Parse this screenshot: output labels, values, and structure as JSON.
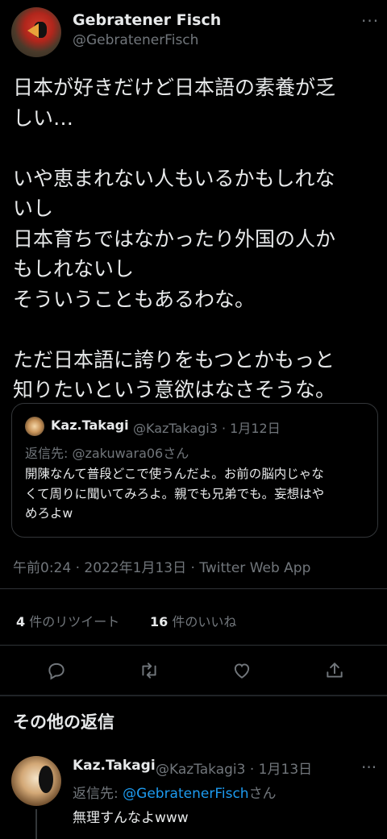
{
  "tweet": {
    "author_name": "Gebratener Fisch",
    "author_handle": "@GebratenerFisch",
    "lines": [
      "日本が好きだけど日本語の素養が乏",
      "しい…",
      "",
      "いや恵まれない人もいるかもしれな",
      "いし",
      "日本育ちではなかったり外国の人か",
      "もしれないし",
      "そういうこともあるわな。",
      "",
      "ただ日本語に誇りをもつとかもっと",
      "知りたいという意欲はなさそうな。"
    ],
    "timestamp": "午前0:24 · 2022年1月13日 · Twitter Web App",
    "retweet_count": "4",
    "retweet_label": "件のリツイート",
    "like_count": "16",
    "like_label": "件のいいね"
  },
  "quote": {
    "author_name": "Kaz.Takagi",
    "author_meta": "@KazTakagi3 · 1月12日",
    "reply_to": "返信先: @zakuwara06さん",
    "lines": [
      "開陳なんて普段どこで使うんだよ。お前の脳内じゃな",
      "くて周りに聞いてみろよ。親でも兄弟でも。妄想はや",
      "めろよw"
    ]
  },
  "icons": [
    "more-icon",
    "reply-icon",
    "retweet-icon",
    "like-icon",
    "share-icon"
  ],
  "replies_section": {
    "title": "その他の返信"
  },
  "reply": {
    "author_name": "Kaz.Takagi",
    "author_meta": "@KazTakagi3 · 1月13日",
    "reply_prefix": "返信先: ",
    "reply_handle": "@GebratenerFisch",
    "reply_suffix": "さん",
    "text": "無理すんなよwww"
  },
  "colors": {
    "background": "#000000",
    "text": "#e7e9ea",
    "muted": "#71767b",
    "link": "#1d9bf0",
    "border": "#2f3336"
  }
}
